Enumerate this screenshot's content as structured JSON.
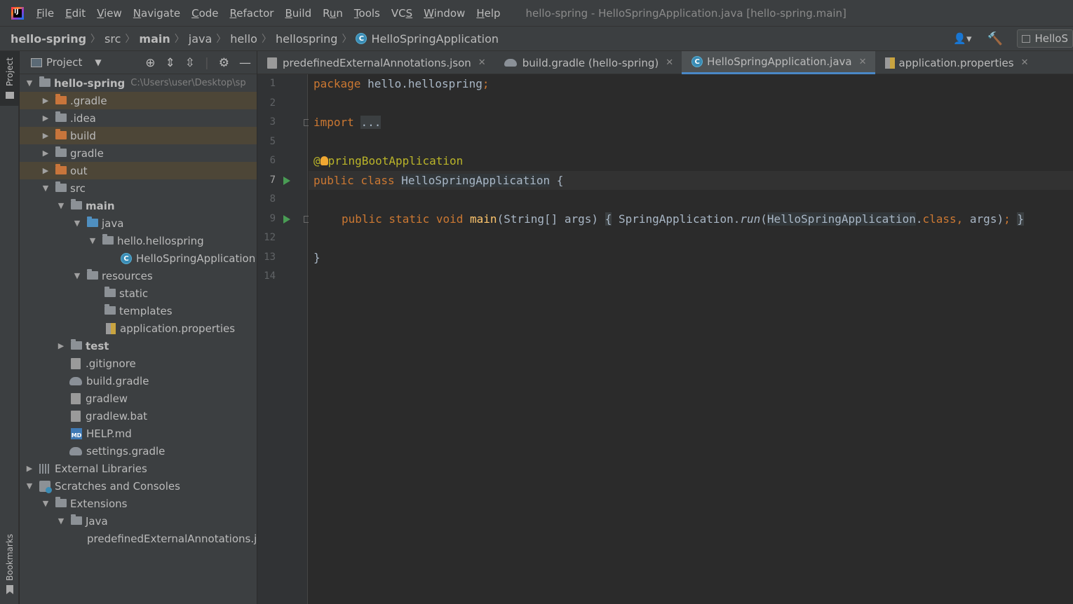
{
  "menubar": {
    "items": [
      "File",
      "Edit",
      "View",
      "Navigate",
      "Code",
      "Refactor",
      "Build",
      "Run",
      "Tools",
      "VCS",
      "Window",
      "Help"
    ],
    "underline": [
      "F",
      "E",
      "V",
      "N",
      "C",
      "R",
      "B",
      "u",
      "T",
      "S",
      "W",
      "H"
    ],
    "window_title": "hello-spring - HelloSpringApplication.java [hello-spring.main]"
  },
  "navbar": {
    "crumbs": [
      "hello-spring",
      "src",
      "main",
      "java",
      "hello",
      "hellospring",
      "HelloSpringApplication"
    ],
    "run_config": "HelloS"
  },
  "left_strip": {
    "project": "Project",
    "bookmarks": "Bookmarks"
  },
  "project_panel": {
    "title": "Project",
    "root": {
      "label": "hello-spring",
      "path": "C:\\Users\\user\\Desktop\\sp"
    },
    "items": [
      ".gradle",
      ".idea",
      "build",
      "gradle",
      "out",
      "src",
      "main",
      "java",
      "hello.hellospring",
      "HelloSpringApplication",
      "resources",
      "static",
      "templates",
      "application.properties",
      "test",
      ".gitignore",
      "build.gradle",
      "gradlew",
      "gradlew.bat",
      "HELP.md",
      "settings.gradle",
      "External Libraries",
      "Scratches and Consoles",
      "Extensions",
      "Java",
      "predefinedExternalAnnotations.j"
    ]
  },
  "editor": {
    "tabs": [
      {
        "label": "predefinedExternalAnnotations.json",
        "active": false
      },
      {
        "label": "build.gradle (hello-spring)",
        "active": false
      },
      {
        "label": "HelloSpringApplication.java",
        "active": true
      },
      {
        "label": "application.properties",
        "active": false
      }
    ],
    "line_numbers": [
      "1",
      "2",
      "3",
      "5",
      "6",
      "7",
      "8",
      "9",
      "12",
      "13",
      "14"
    ],
    "code": {
      "l1_kw": "package",
      "l1_rest": " hello.hellospring",
      "l1_semi": ";",
      "l3_kw": "import",
      "l3_fold": "...",
      "l6_at": "@",
      "l6_rest": "pringBootApplication",
      "l7_kw": "public class",
      "l7_cls": "HelloSpringApplication",
      "l7_rest": " {",
      "l9_kw": "public static void",
      "l9_fn": "main",
      "l9_args": "(String[] args)",
      "l9_fold_open": "{",
      "l9_body1": " SpringApplication.",
      "l9_run": "run",
      "l9_paren": "(",
      "l9_cls": "HelloSpringApplication",
      "l9_dot": ".",
      "l9_class_kw": "class,",
      "l9_end": " args)",
      "l9_semi": ";",
      "l9_fold_close": "}",
      "l13": "}"
    }
  },
  "colors": {
    "keyword": "#cc7832",
    "annotation": "#bbb529",
    "function": "#ffc66d",
    "text": "#a9b7c6",
    "accent": "#4a88c7",
    "run": "#499c54"
  }
}
